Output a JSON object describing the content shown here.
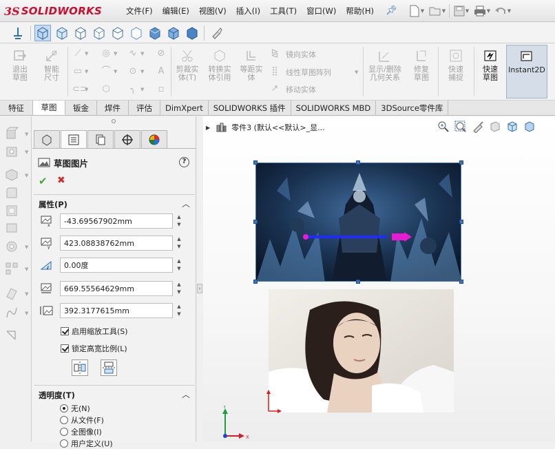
{
  "app": {
    "brand_prefix": "3S",
    "brand_name": "SOLIDWORKS"
  },
  "menu": [
    "文件(F)",
    "编辑(E)",
    "视图(V)",
    "插入(I)",
    "工具(T)",
    "窗口(W)",
    "帮助(H)"
  ],
  "quick_access": [
    "new-icon",
    "open-icon",
    "save-icon",
    "print-icon",
    "undo-icon"
  ],
  "view_toolbar": [
    "sketch-plane-icon",
    "cube-view-1",
    "cube-view-2",
    "cube-view-3",
    "cube-view-4",
    "cube-view-5",
    "cube-view-6",
    "cube-view-7",
    "cube-view-8",
    "flashlight-icon"
  ],
  "command_manager": {
    "exit_sketch": "退出草图",
    "smart_dimension": "智能尺寸",
    "trim": "剪裁实体(T)",
    "convert": "转换实体引用",
    "offset": "等距实体",
    "mirror": "镜向实体",
    "linear_pattern": "线性草图阵列",
    "move": "移动实体",
    "show_relations": "显示/删除几何关系",
    "repair": "修复草图",
    "quick_snaps": "快速捕捉",
    "rapid_sketch": "快速草图",
    "instant2d": "Instant2D"
  },
  "tabs": [
    {
      "label": "特征",
      "active": false
    },
    {
      "label": "草图",
      "active": true
    },
    {
      "label": "钣金",
      "active": false
    },
    {
      "label": "焊件",
      "active": false
    },
    {
      "label": "评估",
      "active": false
    },
    {
      "label": "DimXpert",
      "active": false
    },
    {
      "label": "SOLIDWORKS 插件",
      "active": false
    },
    {
      "label": "SOLIDWORKS MBD",
      "active": false
    },
    {
      "label": "3DSource零件库",
      "active": false
    }
  ],
  "property_manager": {
    "title": "草图图片",
    "properties_section": "属性(P)",
    "fields": {
      "x": "-43.69567902mm",
      "y": "423.08838762mm",
      "angle": "0.00度",
      "width": "669.55564629mm",
      "height": "392.3177615mm"
    },
    "enable_scale_tool": "启用缩放工具(S)",
    "lock_aspect_ratio": "锁定高宽比例(L)",
    "transparency_section": "透明度(T)",
    "transparency_options": [
      "无(N)",
      "从文件(F)",
      "全图像(I)",
      "用户定义(U)"
    ],
    "transparency_selected": 0
  },
  "graphics": {
    "tree_label": "零件3  (默认<<默认>_显..."
  },
  "colors": {
    "accent": "#2a6bc7",
    "brand": "#c8102e",
    "selection": "#3f73c4"
  }
}
